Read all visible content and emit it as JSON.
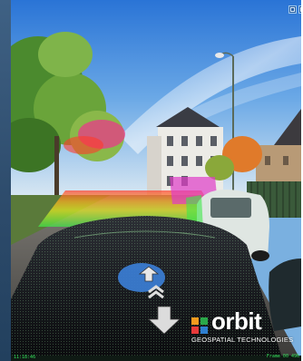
{
  "brand": {
    "name": "orbit",
    "tagline": "GEOSPATIAL TECHNOLOGIES",
    "mark_colors": [
      "#f39a1e",
      "#2aa84a",
      "#e93a3a",
      "#2e7fd0"
    ]
  },
  "hud": {
    "time": "11:18:46",
    "frame": "Frame 00 496"
  },
  "colors": {
    "panel": "#2c4a6a",
    "hud_text": "#34e05a",
    "nav_disc": "#3a7bd0"
  },
  "toolbar": {
    "icons": [
      "window-icon",
      "settings-icon"
    ]
  }
}
